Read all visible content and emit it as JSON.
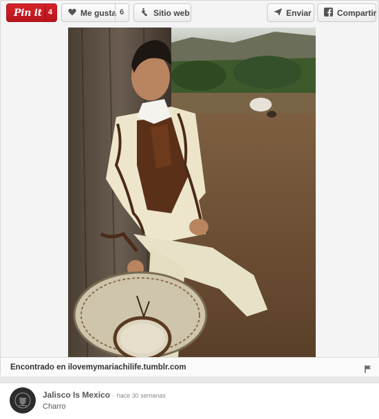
{
  "toolbar": {
    "pin_label": "Pin it",
    "pin_count": "4",
    "like_label": "Me gusta",
    "like_count": "6",
    "website_label": "Sitio web",
    "send_label": "Enviar",
    "share_label": "Compartir"
  },
  "source": {
    "text": "Encontrado en ilovemymariachilife.tumblr.com"
  },
  "pinner": {
    "name": "Jalisco Is Mexico",
    "separator": "·",
    "time": "hace 30 semanas",
    "description": "Charro"
  },
  "icons": {
    "like": "heart-icon",
    "website": "globe-icon",
    "send": "paper-plane-icon",
    "share": "facebook-icon",
    "flag": "flag-icon"
  },
  "colors": {
    "pin_red": "#c9181f",
    "background": "#f4f4f4"
  }
}
